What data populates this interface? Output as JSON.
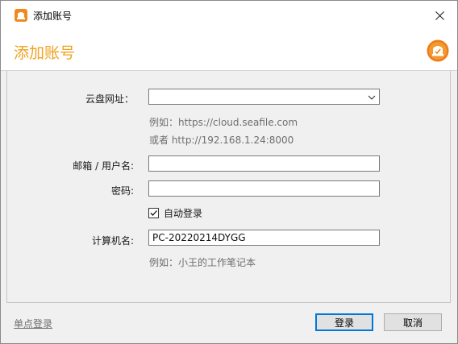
{
  "window": {
    "title": "添加账号"
  },
  "banner": {
    "title": "添加账号"
  },
  "form": {
    "server": {
      "label": "云盘网址：",
      "value": "",
      "hint_example": "例如：https://cloud.seafile.com",
      "hint_or": "或者 http://192.168.1.24:8000"
    },
    "username": {
      "label": "邮箱 / 用户名:",
      "value": ""
    },
    "password": {
      "label": "密码:",
      "value": ""
    },
    "auto_login": {
      "label": "自动登录",
      "checked": true
    },
    "computer_name": {
      "label": "计算机名:",
      "value": "PC-20220214DYGG",
      "hint": "例如：小王的工作笔记本"
    }
  },
  "footer": {
    "sso_link": "单点登录",
    "login_button": "登录",
    "cancel_button": "取消"
  },
  "colors": {
    "accent_orange": "#f0a21f",
    "primary_border": "#0078d7"
  }
}
